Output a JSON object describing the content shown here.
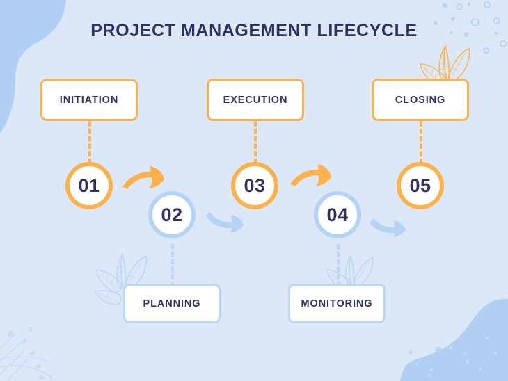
{
  "page": {
    "title": "PROJECT MANAGEMENT LIFECYCLE",
    "background_color": "#dce8f8"
  },
  "colors": {
    "orange": "#fcb24c",
    "blue": "#b5d4f5",
    "blue_light": "#bcd6f5",
    "navy_text": "#2f3161",
    "box_fill": "#ffffff",
    "blob_blue": "#aecdf2"
  },
  "steps": [
    {
      "number": "01",
      "label": "INITIATION",
      "accent": "orange",
      "position": "top"
    },
    {
      "number": "02",
      "label": "PLANNING",
      "accent": "blue",
      "position": "bottom"
    },
    {
      "number": "03",
      "label": "EXECUTION",
      "accent": "orange",
      "position": "top"
    },
    {
      "number": "04",
      "label": "MONITORING",
      "accent": "blue",
      "position": "bottom"
    },
    {
      "number": "05",
      "label": "CLOSING",
      "accent": "orange",
      "position": "top"
    }
  ],
  "arrows": [
    {
      "from": "01",
      "to": "02",
      "color": "#fcb24c",
      "direction": "right-down"
    },
    {
      "from": "02",
      "to": "03",
      "color": "#b5d4f5",
      "direction": "right-up"
    },
    {
      "from": "03",
      "to": "04",
      "color": "#fcb24c",
      "direction": "right-down"
    },
    {
      "from": "04",
      "to": "05",
      "color": "#b5d4f5",
      "direction": "right-up"
    }
  ],
  "decorations": [
    {
      "name": "blob-top-left",
      "color": "#aecdf2"
    },
    {
      "name": "blob-bottom-right",
      "color": "#aecdf2"
    },
    {
      "name": "leaf-sprig-orange-top-right",
      "color": "#fcb24c"
    },
    {
      "name": "leaf-sprig-blue-planning",
      "color": "#bcd6f5"
    },
    {
      "name": "leaf-sprig-blue-monitoring",
      "color": "#bcd6f5"
    },
    {
      "name": "dandelion-bottom-left",
      "color": "#c3daf6"
    },
    {
      "name": "dots-top-right",
      "color": "#aecdf2"
    }
  ]
}
